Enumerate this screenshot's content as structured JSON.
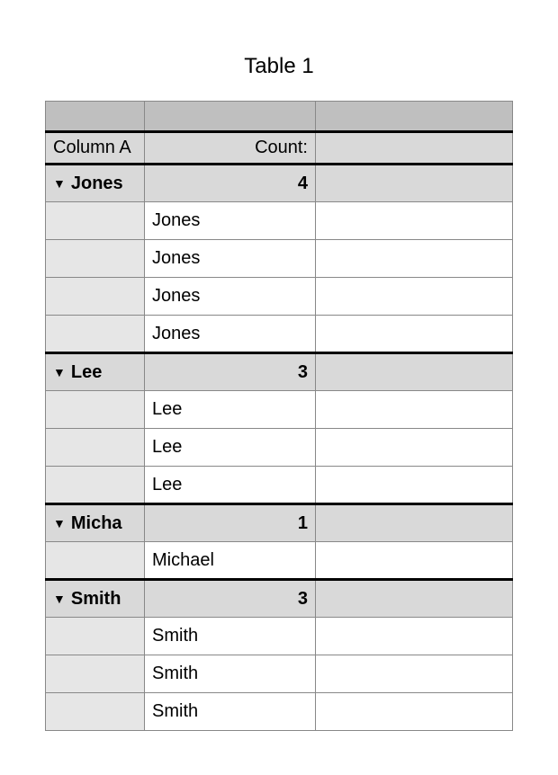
{
  "title": "Table 1",
  "header": {
    "colA": "Column A",
    "countLabel": "Count:"
  },
  "groups": [
    {
      "name": "Jones",
      "count": "4",
      "rows": [
        "Jones",
        "Jones",
        "Jones",
        "Jones"
      ]
    },
    {
      "name": "Lee",
      "count": "3",
      "rows": [
        "Lee",
        "Lee",
        "Lee"
      ]
    },
    {
      "name": "Micha",
      "count": "1",
      "rows": [
        "Michael"
      ]
    },
    {
      "name": "Smith",
      "count": "3",
      "rows": [
        "Smith",
        "Smith",
        "Smith"
      ]
    }
  ]
}
